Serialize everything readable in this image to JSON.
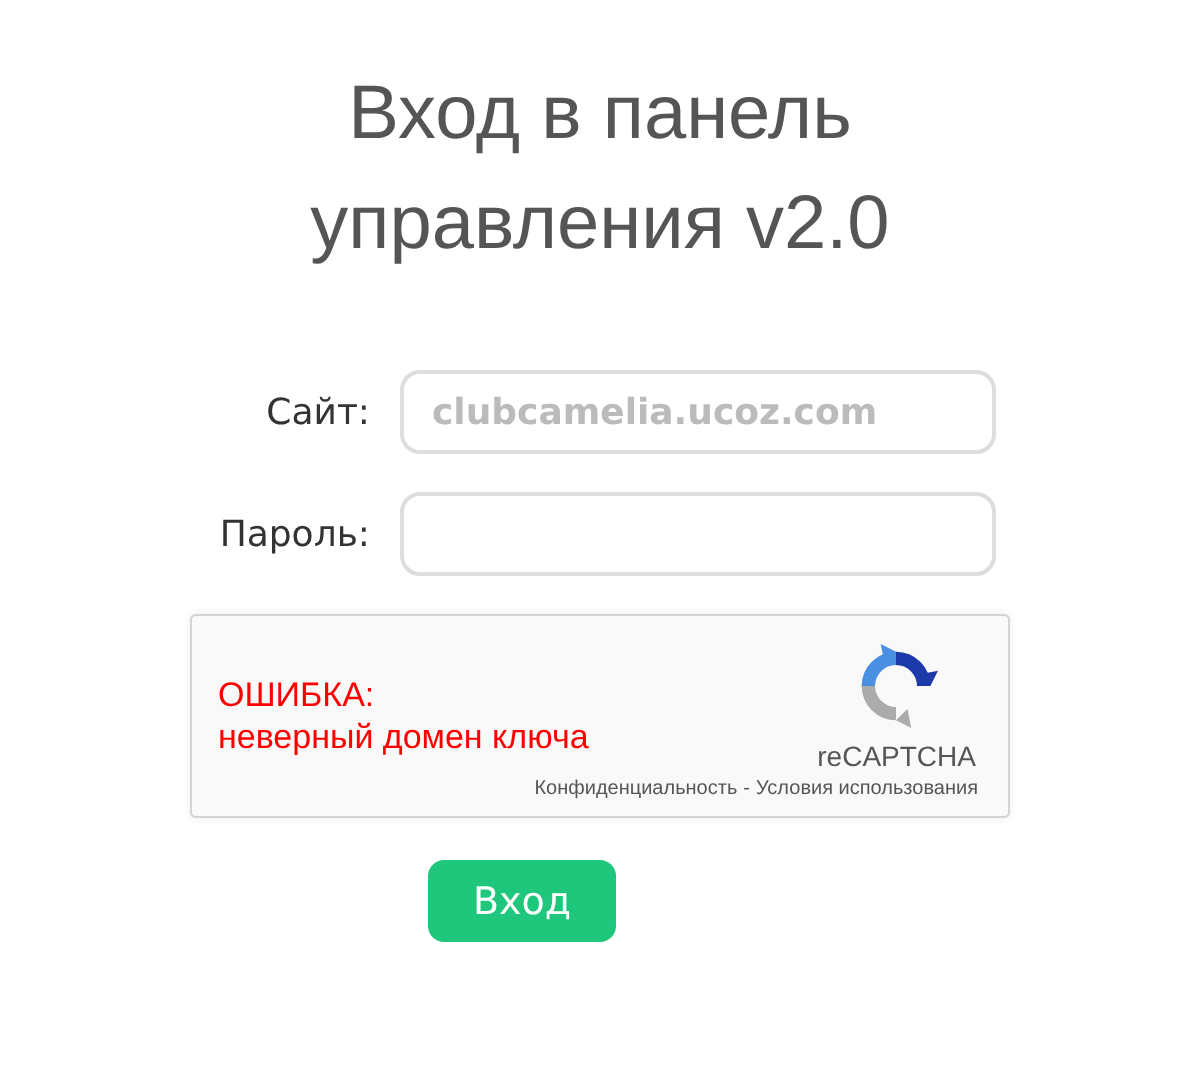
{
  "title": "Вход в панель управления v2.0",
  "fields": [
    {
      "label": "Сайт:",
      "value": "clubcamelia.ucoz.com",
      "disabled": true
    },
    {
      "label": "Пароль:"
    }
  ],
  "recaptcha": {
    "error_title": "ОШИБКА:",
    "error_message": "неверный домен ключа",
    "brand": "reCAPTCHA",
    "links": [
      "Конфиденциальность",
      "Условия использования"
    ],
    "separator": "-"
  },
  "submit_button": "Вход"
}
